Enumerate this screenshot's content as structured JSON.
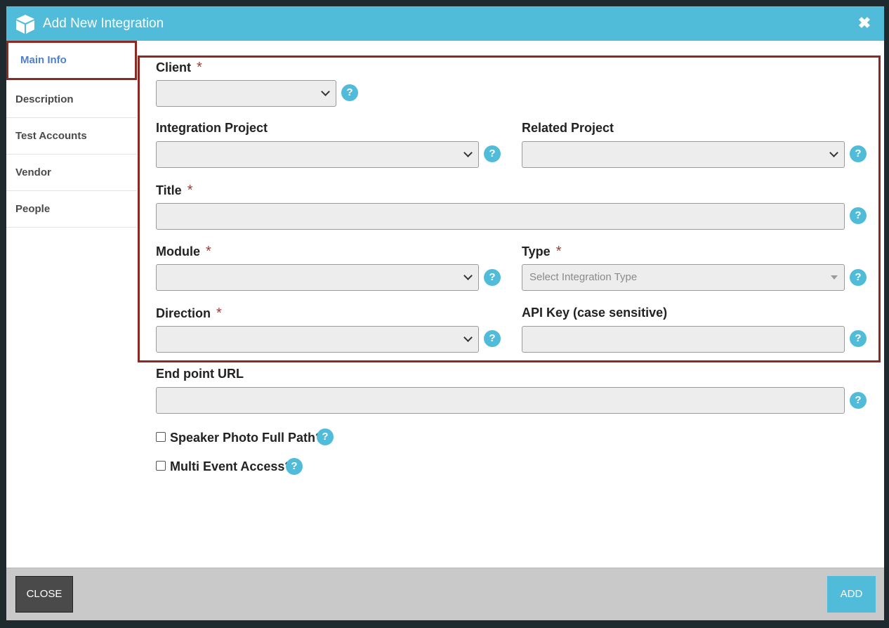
{
  "header": {
    "title": "Add New Integration",
    "close_glyph": "✖"
  },
  "sidebar": {
    "items": [
      {
        "label": "Main Info"
      },
      {
        "label": "Description"
      },
      {
        "label": "Test Accounts"
      },
      {
        "label": "Vendor"
      },
      {
        "label": "People"
      }
    ]
  },
  "form": {
    "required_mark": "*",
    "help_glyph": "?",
    "client": {
      "label": "Client",
      "value": ""
    },
    "integration_project": {
      "label": "Integration Project",
      "value": ""
    },
    "related_project": {
      "label": "Related Project",
      "value": ""
    },
    "title": {
      "label": "Title",
      "value": ""
    },
    "module": {
      "label": "Module",
      "value": ""
    },
    "type": {
      "label": "Type",
      "placeholder": "Select Integration Type"
    },
    "direction": {
      "label": "Direction",
      "value": ""
    },
    "api_key": {
      "label": "API Key (case sensitive)",
      "value": ""
    },
    "endpoint_url": {
      "label": "End point URL",
      "value": ""
    },
    "speaker_photo": {
      "label": "Speaker Photo Full Path?",
      "checked": false
    },
    "multi_event": {
      "label": "Multi Event Access?",
      "checked": false
    }
  },
  "footer": {
    "close_label": "CLOSE",
    "add_label": "ADD"
  },
  "colors": {
    "accent": "#50bcd9",
    "highlight_border": "#8b2a22",
    "active_tab_text": "#4f7fcd"
  },
  "icons": {
    "header": "box-icon",
    "close": "close-icon",
    "help": "help-icon"
  }
}
